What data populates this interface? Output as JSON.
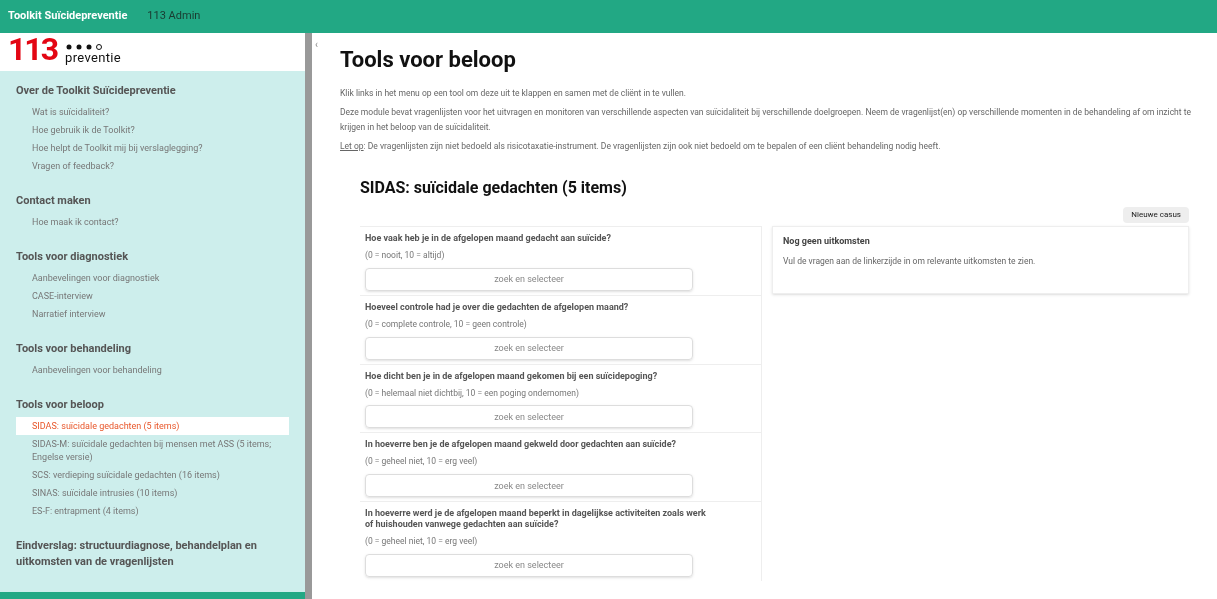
{
  "topbar": {
    "brand": "Toolkit Suïcidepreventie",
    "user": "113 Admin"
  },
  "logo": {
    "number": "113",
    "word": "preventie"
  },
  "sidebar": {
    "sections": [
      {
        "title": "Over de Toolkit Suïcidepreventie",
        "items": [
          {
            "label": "Wat is suïcidaliteit?",
            "selected": false
          },
          {
            "label": "Hoe gebruik ik de Toolkit?",
            "selected": false
          },
          {
            "label": "Hoe helpt de Toolkit mij bij verslaglegging?",
            "selected": false
          },
          {
            "label": "Vragen of feedback?",
            "selected": false
          }
        ]
      },
      {
        "title": "Contact maken",
        "items": [
          {
            "label": "Hoe maak ik contact?",
            "selected": false
          }
        ]
      },
      {
        "title": "Tools voor diagnostiek",
        "items": [
          {
            "label": "Aanbevelingen voor diagnostiek",
            "selected": false
          },
          {
            "label": "CASE-interview",
            "selected": false
          },
          {
            "label": "Narratief interview",
            "selected": false
          }
        ]
      },
      {
        "title": "Tools voor behandeling",
        "items": [
          {
            "label": "Aanbevelingen voor behandeling",
            "selected": false
          }
        ]
      },
      {
        "title": "Tools voor beloop",
        "items": [
          {
            "label": "SIDAS: suïcidale gedachten (5 items)",
            "selected": true
          },
          {
            "label": "SIDAS-M: suïcidale gedachten bij mensen met ASS (5 items; Engelse versie)",
            "selected": false
          },
          {
            "label": "SCS: verdieping suïcidale gedachten (16 items)",
            "selected": false
          },
          {
            "label": "SINAS: suïcidale intrusies (10 items)",
            "selected": false
          },
          {
            "label": "ES-F: entrapment (4 items)",
            "selected": false
          }
        ]
      },
      {
        "title": "Eindverslag: structuurdiagnose, behandelplan en uitkomsten van de vragenlijsten"
      }
    ]
  },
  "collapse_glyph": "‹",
  "page": {
    "title": "Tools voor beloop",
    "intro": [
      "Klik links in het menu op een tool om deze uit te klappen en samen met de cliënt in te vullen.",
      "Deze module bevat vragenlijsten voor het uitvragen en monitoren van verschillende aspecten van suïcidaliteit bij verschillende doelgroepen. Neem de vragenlijst(en) op verschillende momenten in de behandeling af om inzicht te krijgen in het beloop van de suïcidaliteit."
    ],
    "note": {
      "link": "Let op",
      "text": ": De vragenlijsten zijn niet bedoeld als risicotaxatie-instrument. De vragenlijsten zijn ook niet bedoeld om te bepalen of een cliënt behandeling nodig heeft."
    },
    "tool_title": "SIDAS: suïcidale gedachten (5 items)",
    "new_case": "Nieuwe casus",
    "questions": [
      {
        "question": "Hoe vaak heb je in de afgelopen maand gedacht aan suïcide?",
        "scale": "(0 = nooit, 10 = altijd)",
        "placeholder": "zoek en selecteer"
      },
      {
        "question": "Hoeveel controle had je over die gedachten de afgelopen maand?",
        "scale": "(0 = complete controle, 10 = geen controle)",
        "placeholder": "zoek en selecteer"
      },
      {
        "question": "Hoe dicht ben je in de afgelopen maand gekomen bij een suïcidepoging?",
        "scale": "(0 = helemaal niet dichtbij, 10 = een poging ondernomen)",
        "placeholder": "zoek en selecteer"
      },
      {
        "question": "In hoeverre ben je de afgelopen maand gekweld door gedachten aan suïcide?",
        "scale": "(0 = geheel niet, 10 = erg veel)",
        "placeholder": "zoek en selecteer"
      },
      {
        "question": "In hoeverre werd je de afgelopen maand beperkt in dagelijkse activiteiten zoals werk of huishouden vanwege gedachten aan suïcide?",
        "scale": "(0 = geheel niet, 10 = erg veel)",
        "placeholder": "zoek en selecteer"
      }
    ],
    "results": {
      "title": "Nog geen uitkomsten",
      "text": "Vul de vragen aan de linkerzijde in om relevante uitkomsten te zien."
    }
  }
}
